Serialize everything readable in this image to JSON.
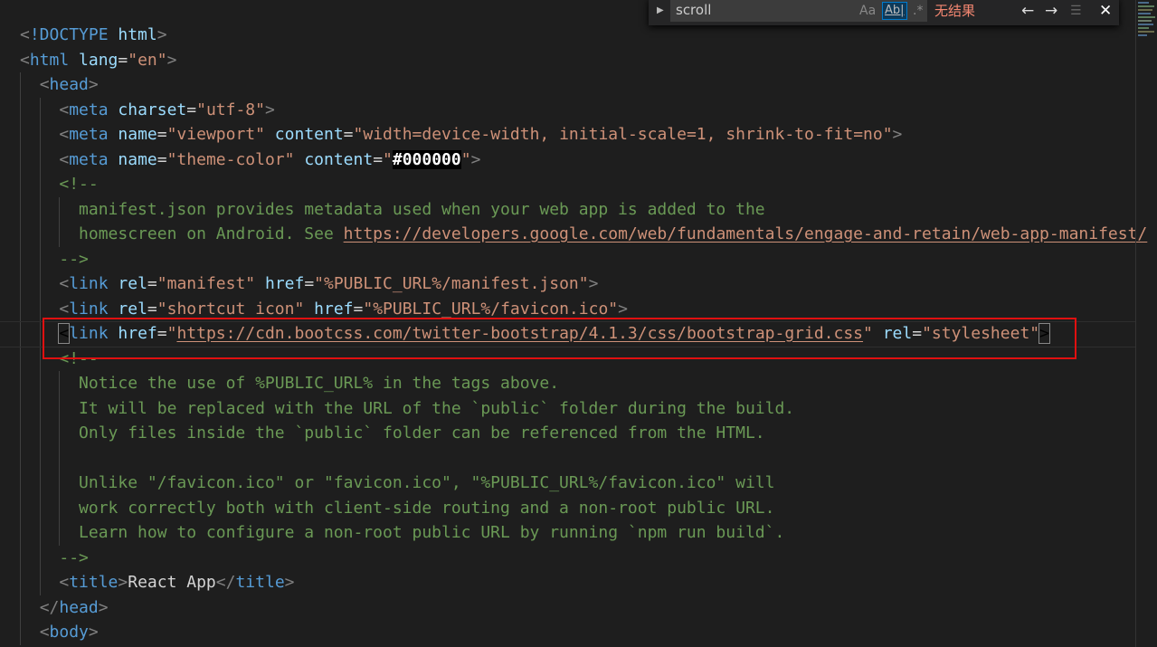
{
  "find_widget": {
    "query": "scroll",
    "match_case_label": "Aa",
    "whole_word_label": "Ab|",
    "regex_label": ".*",
    "result_text": "无结果",
    "prev_icon": "arrow-up-icon",
    "next_icon": "arrow-down-icon",
    "selection_icon": "find-in-selection-icon",
    "close_icon": "close-icon",
    "toggle_icon": "chevron-right-icon"
  },
  "colors": {
    "tag": "#569cd6",
    "attribute": "#9cdcfe",
    "string": "#ce9178",
    "comment": "#6a9955",
    "highlight_box": "#e01010"
  },
  "highlighted_line": 13,
  "lines": [
    [
      [
        "p",
        "<"
      ],
      [
        "t",
        "!DOCTYPE"
      ],
      [
        "a",
        " html"
      ],
      [
        "p",
        ">"
      ]
    ],
    [
      [
        "p",
        "<"
      ],
      [
        "t",
        "html"
      ],
      [
        "a",
        " lang"
      ],
      [
        "x",
        "="
      ],
      [
        "s",
        "\"en\""
      ],
      [
        "p",
        ">"
      ]
    ],
    [
      [
        "x",
        "  "
      ],
      [
        "p",
        "<"
      ],
      [
        "t",
        "head"
      ],
      [
        "p",
        ">"
      ]
    ],
    [
      [
        "x",
        "    "
      ],
      [
        "p",
        "<"
      ],
      [
        "t",
        "meta"
      ],
      [
        "a",
        " charset"
      ],
      [
        "x",
        "="
      ],
      [
        "s",
        "\"utf-8\""
      ],
      [
        "p",
        ">"
      ]
    ],
    [
      [
        "x",
        "    "
      ],
      [
        "p",
        "<"
      ],
      [
        "t",
        "meta"
      ],
      [
        "a",
        " name"
      ],
      [
        "x",
        "="
      ],
      [
        "s",
        "\"viewport\""
      ],
      [
        "a",
        " content"
      ],
      [
        "x",
        "="
      ],
      [
        "s",
        "\"width=device-width, initial-scale=1, shrink-to-fit=no\""
      ],
      [
        "p",
        ">"
      ]
    ],
    [
      [
        "x",
        "    "
      ],
      [
        "p",
        "<"
      ],
      [
        "t",
        "meta"
      ],
      [
        "a",
        " name"
      ],
      [
        "x",
        "="
      ],
      [
        "s",
        "\"theme-color\""
      ],
      [
        "a",
        " content"
      ],
      [
        "x",
        "="
      ],
      [
        "s",
        "\""
      ],
      [
        "k",
        "#000000"
      ],
      [
        "s",
        "\""
      ],
      [
        "p",
        ">"
      ]
    ],
    [
      [
        "x",
        "    "
      ],
      [
        "c",
        "<!--"
      ]
    ],
    [
      [
        "x",
        "      "
      ],
      [
        "c",
        "manifest.json provides metadata used when your web app is added to the"
      ]
    ],
    [
      [
        "x",
        "      "
      ],
      [
        "c",
        "homescreen on Android. See "
      ],
      [
        "u",
        "https://developers.google.com/web/fundamentals/engage-and-retain/web-app-manifest/"
      ]
    ],
    [
      [
        "x",
        "    "
      ],
      [
        "c",
        "-->"
      ]
    ],
    [
      [
        "x",
        "    "
      ],
      [
        "p",
        "<"
      ],
      [
        "t",
        "link"
      ],
      [
        "a",
        " rel"
      ],
      [
        "x",
        "="
      ],
      [
        "s",
        "\"manifest\""
      ],
      [
        "a",
        " href"
      ],
      [
        "x",
        "="
      ],
      [
        "s",
        "\"%PUBLIC_URL%/manifest.json\""
      ],
      [
        "p",
        ">"
      ]
    ],
    [
      [
        "x",
        "    "
      ],
      [
        "p",
        "<"
      ],
      [
        "t",
        "link"
      ],
      [
        "a",
        " rel"
      ],
      [
        "x",
        "="
      ],
      [
        "s",
        "\"shortcut icon\""
      ],
      [
        "a",
        " href"
      ],
      [
        "x",
        "="
      ],
      [
        "s",
        "\"%PUBLIC_URL%/favicon.ico\""
      ],
      [
        "p",
        ">"
      ]
    ],
    [
      [
        "x",
        "    "
      ],
      [
        "cu",
        "<"
      ],
      [
        "t",
        "link"
      ],
      [
        "a",
        " href"
      ],
      [
        "x",
        "="
      ],
      [
        "s",
        "\""
      ],
      [
        "u",
        "https://cdn.bootcss.com/twitter-bootstrap/4.1.3/css/bootstrap-grid.css"
      ],
      [
        "s",
        "\""
      ],
      [
        "a",
        " rel"
      ],
      [
        "x",
        "="
      ],
      [
        "s",
        "\"stylesheet\""
      ],
      [
        "cu",
        ">"
      ]
    ],
    [
      [
        "x",
        "    "
      ],
      [
        "c",
        "<!--"
      ]
    ],
    [
      [
        "x",
        "      "
      ],
      [
        "c",
        "Notice the use of %PUBLIC_URL% in the tags above."
      ]
    ],
    [
      [
        "x",
        "      "
      ],
      [
        "c",
        "It will be replaced with the URL of the `public` folder during the build."
      ]
    ],
    [
      [
        "x",
        "      "
      ],
      [
        "c",
        "Only files inside the `public` folder can be referenced from the HTML."
      ]
    ],
    [
      [
        "x",
        "      "
      ]
    ],
    [
      [
        "x",
        "      "
      ],
      [
        "c",
        "Unlike \"/favicon.ico\" or \"favicon.ico\", \"%PUBLIC_URL%/favicon.ico\" will"
      ]
    ],
    [
      [
        "x",
        "      "
      ],
      [
        "c",
        "work correctly both with client-side routing and a non-root public URL."
      ]
    ],
    [
      [
        "x",
        "      "
      ],
      [
        "c",
        "Learn how to configure a non-root public URL by running `npm run build`."
      ]
    ],
    [
      [
        "x",
        "    "
      ],
      [
        "c",
        "-->"
      ]
    ],
    [
      [
        "x",
        "    "
      ],
      [
        "p",
        "<"
      ],
      [
        "t",
        "title"
      ],
      [
        "p",
        ">"
      ],
      [
        "x",
        "React App"
      ],
      [
        "p",
        "</"
      ],
      [
        "t",
        "title"
      ],
      [
        "p",
        ">"
      ]
    ],
    [
      [
        "x",
        "  "
      ],
      [
        "p",
        "</"
      ],
      [
        "t",
        "head"
      ],
      [
        "p",
        ">"
      ]
    ],
    [
      [
        "x",
        "  "
      ],
      [
        "p",
        "<"
      ],
      [
        "t",
        "body"
      ],
      [
        "p",
        ">"
      ]
    ]
  ]
}
